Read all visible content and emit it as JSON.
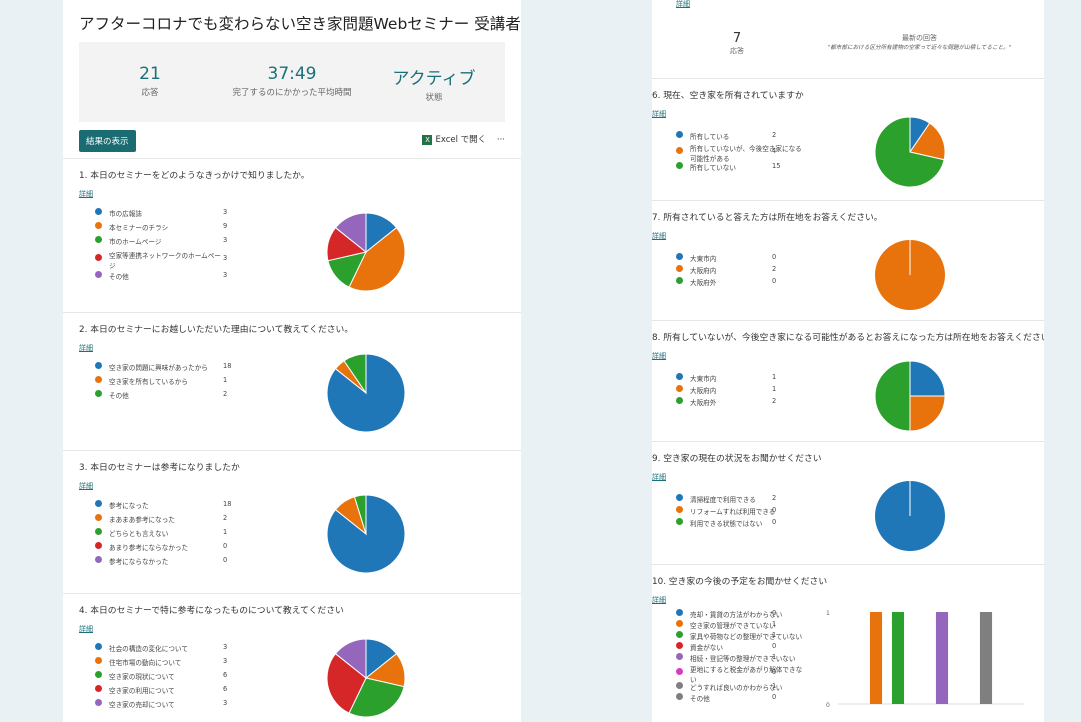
{
  "colors": {
    "blue": "#1f77b8",
    "orange": "#e8730c",
    "green": "#2ca02c",
    "red": "#d62728",
    "purple": "#9467bd",
    "magenta": "#d83bbf",
    "gray": "#7f7f7f"
  },
  "left": {
    "title": "アフターコロナでも変わらない空き家問題Webセミナー 受講者アンケート",
    "stats": [
      {
        "value": "21",
        "label": "応答"
      },
      {
        "value": "37:49",
        "label": "完了するのにかかった平均時間"
      },
      {
        "value": "アクティブ",
        "label": "状態"
      }
    ],
    "results_button": "結果の表示",
    "excel_label": "Excel で開く",
    "excel_icon": "excel-icon",
    "more": "···",
    "details": "詳細",
    "questions": [
      {
        "title": "1. 本日のセミナーをどのようなきっかけで知りましたか。",
        "items": [
          {
            "label": "市の広報誌",
            "count": "3"
          },
          {
            "label": "本セミナーのチラシ",
            "count": "9"
          },
          {
            "label": "市のホームページ",
            "count": "3"
          },
          {
            "label": "空家等連携ネットワークのホームペー",
            "label2": "ジ",
            "count": "3"
          },
          {
            "label": "その他",
            "count": "3"
          }
        ]
      },
      {
        "title": "2. 本日のセミナーにお越しいただいた理由について教えてください。",
        "items": [
          {
            "label": "空き家の問題に興味があったから",
            "count": "18"
          },
          {
            "label": "空き家を所有しているから",
            "count": "1"
          },
          {
            "label": "その他",
            "count": "2"
          }
        ]
      },
      {
        "title": "3. 本日のセミナーは参考になりましたか",
        "items": [
          {
            "label": "参考になった",
            "count": "18"
          },
          {
            "label": "まあまあ参考になった",
            "count": "2"
          },
          {
            "label": "どちらとも言えない",
            "count": "1"
          },
          {
            "label": "あまり参考にならなかった",
            "count": "0"
          },
          {
            "label": "参考にならなかった",
            "count": "0"
          }
        ]
      },
      {
        "title": "4. 本日のセミナーで特に参考になったものについて教えてください",
        "items": [
          {
            "label": "社会の構造の変化について",
            "count": "3"
          },
          {
            "label": "住宅市場の動向について",
            "count": "3"
          },
          {
            "label": "空き家の現状について",
            "count": "6"
          },
          {
            "label": "空き家の利用について",
            "count": "6"
          },
          {
            "label": "空き家の売却について",
            "count": "3"
          }
        ]
      }
    ]
  },
  "right": {
    "details": "詳細",
    "responses_value": "7",
    "responses_label": "応答",
    "latest_label": "最新の回答",
    "latest_text": "\"都市部における区分所有建物の空家って近々な問題が山積してること。\"",
    "questions": [
      {
        "title": "6. 現在、空き家を所有されていますか",
        "items": [
          {
            "label": "所有している",
            "count": "2"
          },
          {
            "label": "所有していないが、今後空き家になる",
            "label2": "可能性がある",
            "count": "4"
          },
          {
            "label": "所有していない",
            "count": "15"
          }
        ]
      },
      {
        "title": "7. 所有されていると答えた方は所在地をお答えください。",
        "items": [
          {
            "label": "大東市内",
            "count": "0"
          },
          {
            "label": "大阪府内",
            "count": "2"
          },
          {
            "label": "大阪府外",
            "count": "0"
          }
        ]
      },
      {
        "title": "8. 所有していないが、今後空き家になる可能性があるとお答えになった方は所在地をお答えください。",
        "items": [
          {
            "label": "大東市内",
            "count": "1"
          },
          {
            "label": "大阪府内",
            "count": "1"
          },
          {
            "label": "大阪府外",
            "count": "2"
          }
        ]
      },
      {
        "title": "9. 空き家の現在の状況をお聞かせください",
        "items": [
          {
            "label": "清掃程度で利用できる",
            "count": "2"
          },
          {
            "label": "リフォームすれば利用できる",
            "count": "0"
          },
          {
            "label": "利用できる状態ではない",
            "count": "0"
          }
        ]
      },
      {
        "title": "10. 空き家の今後の予定をお聞かせください",
        "items": [
          {
            "label": "売却・賃貸の方法がわからない",
            "count": "0"
          },
          {
            "label": "空き家の管理ができていない",
            "count": "1"
          },
          {
            "label": "家具や荷物などの整理ができていない",
            "count": "1"
          },
          {
            "label": "資金がない",
            "count": "0"
          },
          {
            "label": "相続・登記等の整理ができていない",
            "count": "1"
          },
          {
            "label": "更地にすると税金があがり解体できな",
            "label2": "い",
            "count": "0"
          },
          {
            "label": "どうすれば良いのかわからない",
            "count": "1"
          },
          {
            "label": "その他",
            "count": "0"
          }
        ]
      }
    ]
  },
  "chart_data": [
    {
      "type": "pie",
      "categories": [
        "市の広報誌",
        "本セミナーのチラシ",
        "市のホームページ",
        "空家等連携ネットワークのホームページ",
        "その他"
      ],
      "values": [
        3,
        9,
        3,
        3,
        3
      ]
    },
    {
      "type": "pie",
      "categories": [
        "空き家の問題に興味があったから",
        "空き家を所有しているから",
        "その他"
      ],
      "values": [
        18,
        1,
        2
      ]
    },
    {
      "type": "pie",
      "categories": [
        "参考になった",
        "まあまあ参考になった",
        "どちらとも言えない",
        "あまり参考にならなかった",
        "参考にならなかった"
      ],
      "values": [
        18,
        2,
        1,
        0,
        0
      ]
    },
    {
      "type": "pie",
      "categories": [
        "社会の構造の変化について",
        "住宅市場の動向について",
        "空き家の現状について",
        "空き家の利用について",
        "空き家の売却について"
      ],
      "values": [
        3,
        3,
        6,
        6,
        3
      ]
    },
    {
      "type": "pie",
      "categories": [
        "所有している",
        "所有していないが、今後空き家になる可能性がある",
        "所有していない"
      ],
      "values": [
        2,
        4,
        15
      ]
    },
    {
      "type": "pie",
      "categories": [
        "大東市内",
        "大阪府内",
        "大阪府外"
      ],
      "values": [
        0,
        2,
        0
      ]
    },
    {
      "type": "pie",
      "categories": [
        "大東市内",
        "大阪府内",
        "大阪府外"
      ],
      "values": [
        1,
        1,
        2
      ]
    },
    {
      "type": "pie",
      "categories": [
        "清掃程度で利用できる",
        "リフォームすれば利用できる",
        "利用できる状態ではない"
      ],
      "values": [
        2,
        0,
        0
      ]
    },
    {
      "type": "bar",
      "categories": [
        "売却・賃貸の方法がわからない",
        "空き家の管理ができていない",
        "家具や荷物などの整理ができていない",
        "資金がない",
        "相続・登記等の整理ができていない",
        "更地にすると税金があがり解体できない",
        "どうすれば良いのかわからない",
        "その他"
      ],
      "values": [
        0,
        1,
        1,
        0,
        1,
        0,
        1,
        0
      ],
      "ylim": [
        0,
        1
      ],
      "yticks": [
        "0",
        "1"
      ]
    }
  ]
}
